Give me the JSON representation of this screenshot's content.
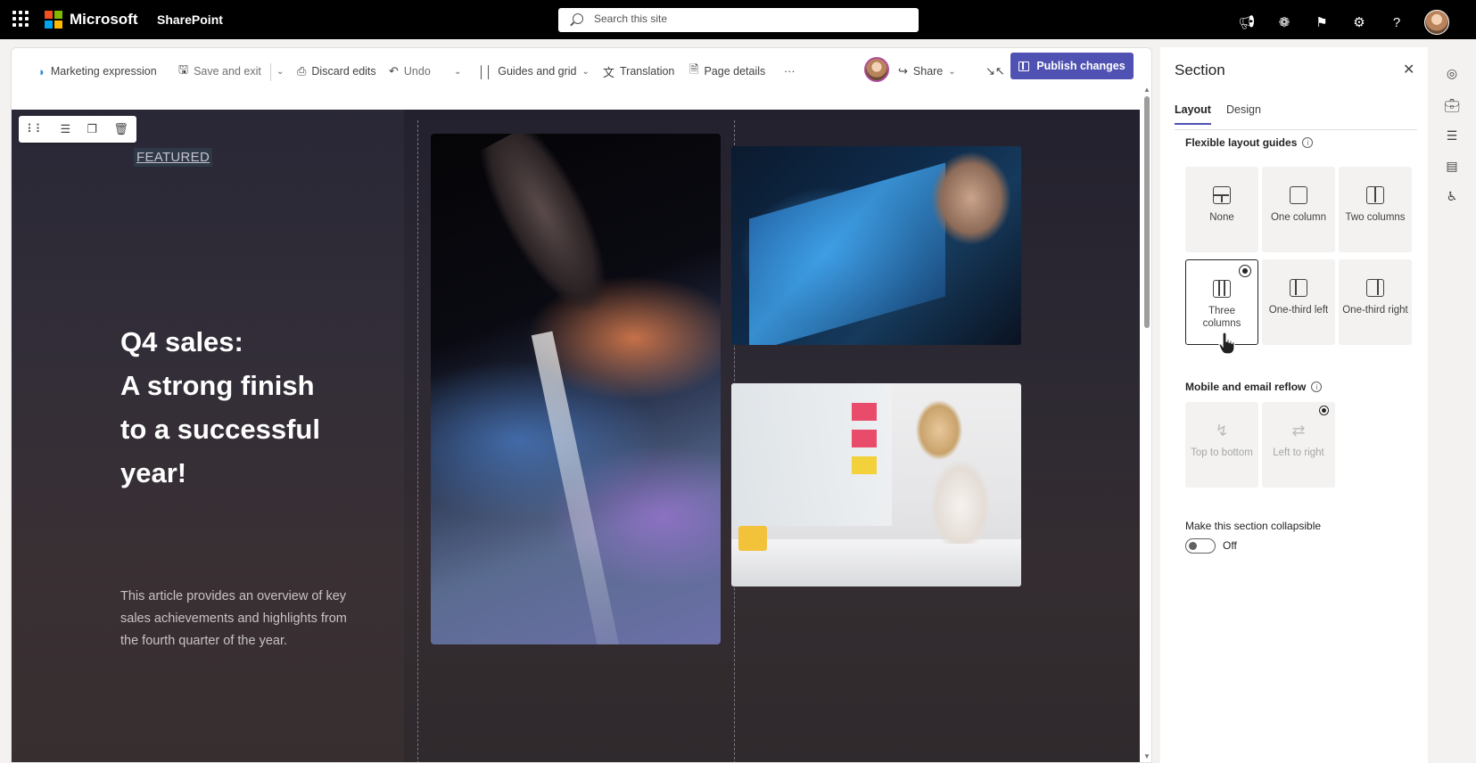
{
  "suite": {
    "brand": "Microsoft",
    "app": "SharePoint",
    "search_placeholder": "Search this site",
    "brand_colors": [
      "#f25022",
      "#7fba00",
      "#00a4ef",
      "#ffb900"
    ]
  },
  "toolbar": {
    "page_name": "Marketing expression",
    "save_exit": "Save and exit",
    "discard": "Discard edits",
    "undo": "Undo",
    "guides": "Guides and grid",
    "translation": "Translation",
    "page_details": "Page details",
    "more": "···",
    "share": "Share",
    "publish": "Publish changes",
    "accent_color": "#4f52b2"
  },
  "canvas": {
    "featured": "FEATURED",
    "headline": [
      "Q4 sales:",
      "A strong finish",
      "to a successful",
      "year!"
    ],
    "description": "This article provides an overview of key sales achievements and highlights from the fourth quarter of the year."
  },
  "panel": {
    "title": "Section",
    "tabs": [
      "Layout",
      "Design"
    ],
    "active_tab": "Layout",
    "layout_guides_label": "Flexible layout guides",
    "layouts": [
      "None",
      "One column",
      "Two columns",
      "Three columns",
      "One-third left",
      "One-third right"
    ],
    "selected_layout": "Three columns",
    "reflow_label": "Mobile and email reflow",
    "reflow_options": [
      "Top to bottom",
      "Left to right"
    ],
    "collapsible_label": "Make this section collapsible",
    "collapsible_state": "Off"
  }
}
